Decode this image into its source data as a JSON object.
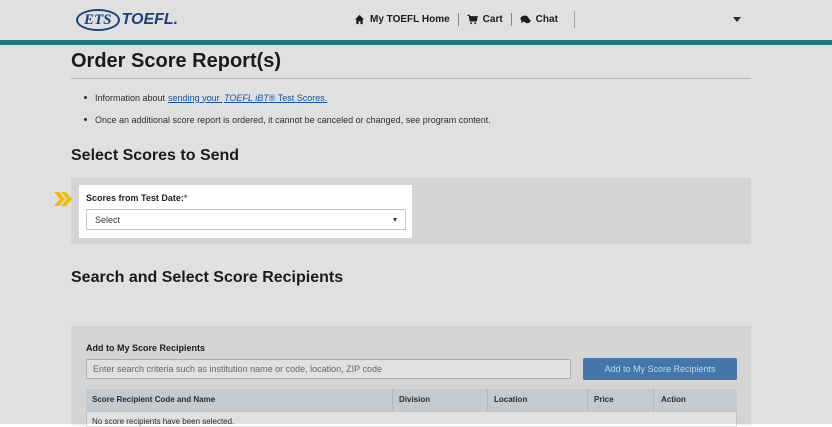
{
  "header": {
    "logo_ets": "ETS",
    "logo_toefl": "TOEFL.",
    "nav": [
      {
        "label": "My TOEFL Home",
        "icon": "home-icon"
      },
      {
        "label": "Cart",
        "icon": "cart-icon"
      },
      {
        "label": "Chat",
        "icon": "chat-icon"
      }
    ],
    "accent_color": "#1f8a8a"
  },
  "page": {
    "title": "Order Score Report(s)",
    "bullets": {
      "b1_prefix": "Information about ",
      "b1_link_1": "sending your ",
      "b1_link_2": "TOEFL iBT",
      "b1_link_3": "®",
      "b1_suffix": " Test Scores.",
      "b2": "Once an additional score report is ordered, it cannot be canceled or changed, see program content."
    }
  },
  "select_scores": {
    "title": "Select Scores to Send",
    "field_label": "Scores from Test Date:",
    "required_mark": "*",
    "select_value": "Select"
  },
  "recipients": {
    "title": "Search and Select Score Recipients",
    "panel_label": "Add to My Score Recipients",
    "search_placeholder": "Enter search criteria such as institution name or code, location, ZIP code",
    "add_button": "Add to My Score Recipients",
    "columns": [
      "Score Recipient Code and Name",
      "Division",
      "Location",
      "Price",
      "Action"
    ],
    "empty_text": "No score recipients have been selected."
  }
}
